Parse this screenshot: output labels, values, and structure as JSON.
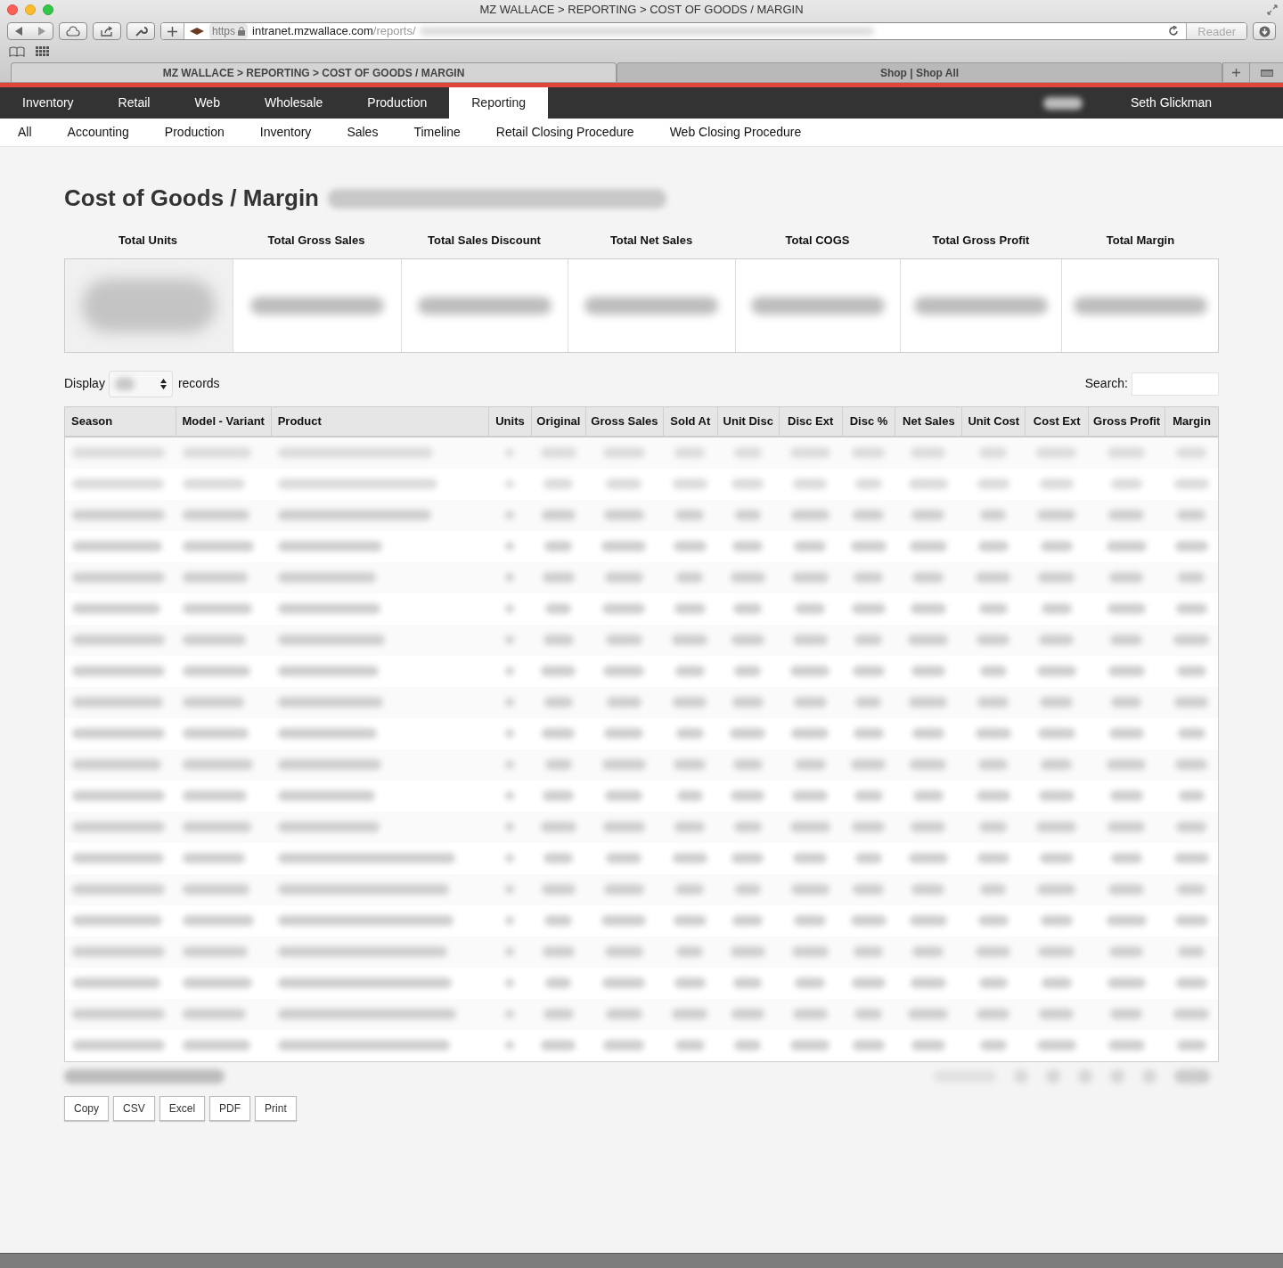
{
  "browser": {
    "title": "MZ WALLACE > REPORTING > COST OF GOODS / MARGIN",
    "url": {
      "scheme": "https",
      "host": "intranet.mzwallace.com",
      "path": "/reports/"
    },
    "reader": "Reader",
    "tabs": [
      {
        "label": "MZ WALLACE > REPORTING > COST OF GOODS / MARGIN",
        "selected": true
      },
      {
        "label": "Shop | Shop All",
        "selected": false
      }
    ]
  },
  "main_nav": [
    {
      "label": "Inventory",
      "selected": false
    },
    {
      "label": "Retail",
      "selected": false
    },
    {
      "label": "Web",
      "selected": false
    },
    {
      "label": "Wholesale",
      "selected": false
    },
    {
      "label": "Production",
      "selected": false
    },
    {
      "label": "Reporting",
      "selected": true
    }
  ],
  "user": "Seth Glickman",
  "sub_nav": [
    "All",
    "Accounting",
    "Production",
    "Inventory",
    "Sales",
    "Timeline",
    "Retail Closing Procedure",
    "Web Closing Procedure"
  ],
  "page_title": "Cost of Goods / Margin",
  "summary_columns": [
    "Total Units",
    "Total Gross Sales",
    "Total Sales Discount",
    "Total Net Sales",
    "Total COGS",
    "Total Gross Profit",
    "Total Margin"
  ],
  "display_label": "Display",
  "records_label": "records",
  "search_label": "Search:",
  "table": {
    "columns": [
      "Season",
      "Model - Variant",
      "Product",
      "Units",
      "Original",
      "Gross Sales",
      "Sold At",
      "Unit Disc",
      "Disc Ext",
      "Disc %",
      "Net Sales",
      "Unit Cost",
      "Cost Ext",
      "Gross Profit",
      "Margin"
    ]
  },
  "export_buttons": [
    "Copy",
    "CSV",
    "Excel",
    "PDF",
    "Print"
  ]
}
